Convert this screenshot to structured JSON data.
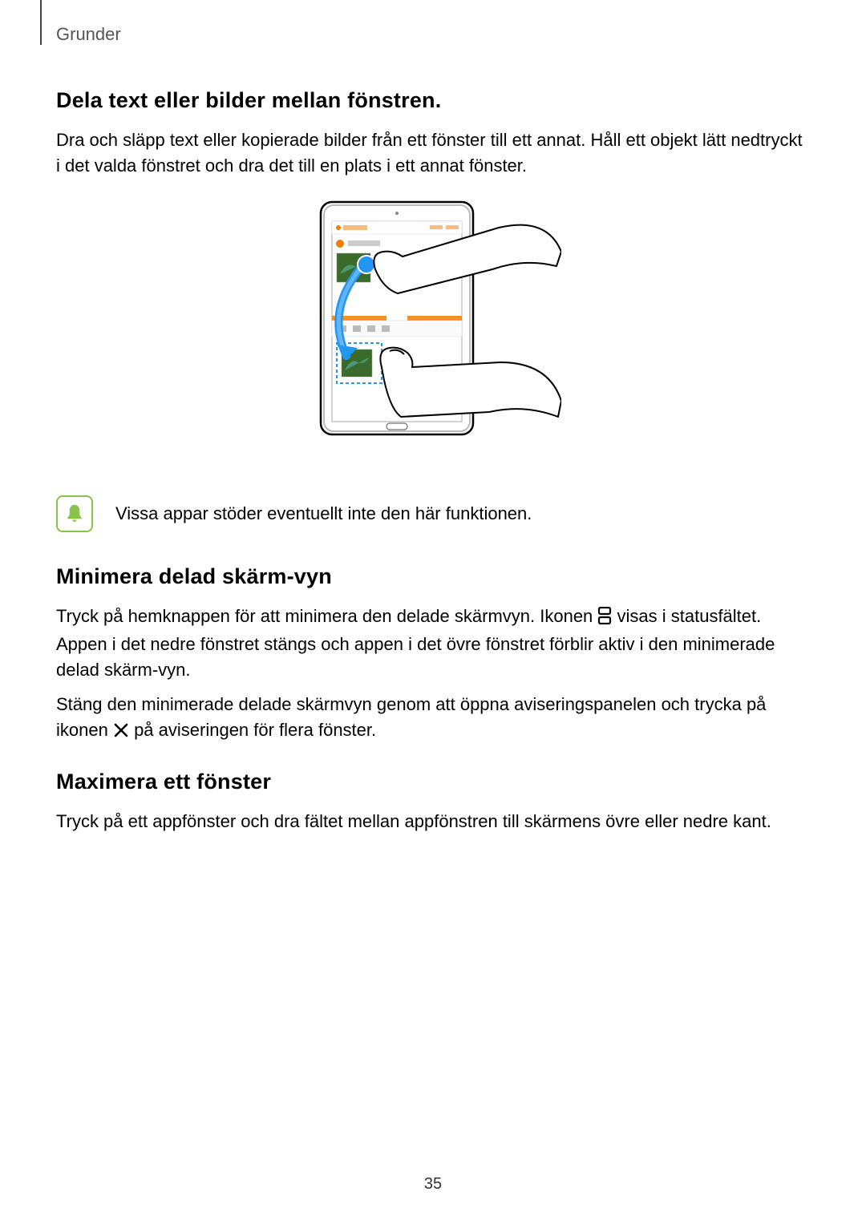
{
  "header": {
    "section": "Grunder"
  },
  "sec1": {
    "title": "Dela text eller bilder mellan fönstren.",
    "para1": "Dra och släpp text eller kopierade bilder från ett fönster till ett annat. Håll ett objekt lätt nedtryckt i det valda fönstret och dra det till en plats i ett annat fönster."
  },
  "note": {
    "text": "Vissa appar stöder eventuellt inte den här funktionen."
  },
  "sec2": {
    "title": "Minimera delad skärm-vyn",
    "p1a": "Tryck på hemknappen för att minimera den delade skärmvyn. Ikonen ",
    "p1b": " visas i statusfältet. Appen i det nedre fönstret stängs och appen i det övre fönstret förblir aktiv i den minimerade delad skärm-vyn.",
    "p2a": "Stäng den minimerade delade skärmvyn genom att öppna aviseringspanelen och trycka på ikonen ",
    "p2b": " på aviseringen för flera fönster."
  },
  "sec3": {
    "title": "Maximera ett fönster",
    "para1": "Tryck på ett appfönster och dra fältet mellan appfönstren till skärmens övre eller nedre kant."
  },
  "page_number": "35"
}
